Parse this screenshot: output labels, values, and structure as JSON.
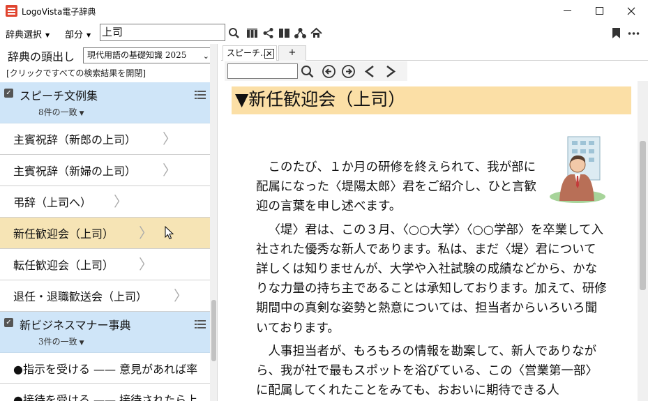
{
  "window": {
    "title": "LogoVista電子辞典",
    "minimize_icon": "minimize-icon",
    "maximize_icon": "maximize-icon",
    "close_icon": "close-icon"
  },
  "toolbar": {
    "dict_select_label": "辞典選択",
    "part_label": "部分",
    "search_value": "上司",
    "icons": [
      "search-icon",
      "library-icon",
      "share-icon",
      "columns-icon",
      "tree-icon",
      "home-icon",
      "bookmark-icon",
      "more-icon"
    ]
  },
  "left_pane": {
    "headword_label": "辞典の頭出し",
    "dictionary_selected": "現代用語の基礎知識 2025",
    "expand_all_label": "[クリックですべての検索結果を開閉]",
    "groups": [
      {
        "title": "スピーチ文例集",
        "count": "8件の一致",
        "checked": true,
        "items": [
          {
            "label": "主賓祝辞（新郎の上司）",
            "active": false
          },
          {
            "label": "主賓祝辞（新婦の上司）",
            "active": false
          },
          {
            "label": "弔辞（上司へ）",
            "active": false
          },
          {
            "label": "新任歓迎会（上司）",
            "active": true
          },
          {
            "label": "転任歓迎会（上司）",
            "active": false
          },
          {
            "label": "退任・退職歓送会（上司）",
            "active": false
          }
        ]
      },
      {
        "title": "新ビジネスマナー事典",
        "count": "3件の一致",
        "checked": true,
        "items": [
          {
            "label": "●指示を受ける —— 意見があれば率"
          },
          {
            "label": "●接待を受ける —— 接待されたら上"
          }
        ]
      }
    ]
  },
  "right_pane": {
    "tab_label": "スピーチ…",
    "tab_close": "×",
    "tab_new": "+",
    "article": {
      "title": "▼新任歓迎会（上司）",
      "paragraphs": [
        "このたび、１か月の研修を終えられて、我が部に配属になった〈堤陽太郎〉君をご紹介し、ひと言歓迎の言葉を申し述べます。",
        "〈堤〉君は、この３月、〈○○大学〉〈○○学部〉を卒業して入社された優秀な新人であります。私は、まだ〈堤〉君について詳しくは知りませんが、大学や入社試験の成績などから、かなりな力量の持ち主であることは承知しております。加えて、研修期間中の真剣な姿勢と熱意については、担当者からいろいろ聞いております。",
        "人事担当者が、もろもろの情報を勘案して、新人でありながら、我が社で最もスポットを浴びている、この〈営業第一部〉に配属してくれたことをみても、おおいに期待できる人"
      ]
    }
  }
}
